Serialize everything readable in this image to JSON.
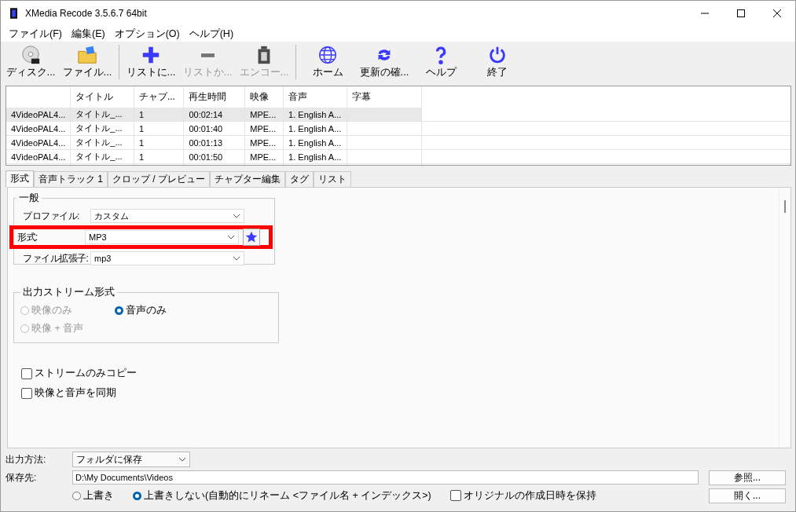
{
  "window": {
    "title": "XMedia Recode 3.5.6.7 64bit"
  },
  "menu": [
    "ファイル(F)",
    "編集(E)",
    "オプション(O)",
    "ヘルプ(H)"
  ],
  "toolbar": [
    {
      "kind": "disc",
      "label": "ディスク...",
      "disabled": false
    },
    {
      "kind": "folder",
      "label": "ファイル...",
      "disabled": false
    },
    {
      "kind": "sep"
    },
    {
      "kind": "plus",
      "label": "リストに...",
      "disabled": false
    },
    {
      "kind": "minus",
      "label": "リストか...",
      "disabled": true
    },
    {
      "kind": "encode",
      "label": "エンコー...",
      "disabled": true
    },
    {
      "kind": "sep"
    },
    {
      "kind": "globe",
      "label": "ホーム",
      "disabled": false
    },
    {
      "kind": "refresh",
      "label": "更新の確...",
      "disabled": false
    },
    {
      "kind": "help",
      "label": "ヘルプ",
      "disabled": false
    },
    {
      "kind": "power",
      "label": "終了",
      "disabled": false
    }
  ],
  "table": {
    "columns": [
      "",
      "タイトル",
      "チャプ...",
      "再生時間",
      "映像",
      "音声",
      "字幕"
    ],
    "rows": [
      {
        "selected": true,
        "cells": [
          "4VideoPAL4...",
          "タイトル_...",
          "1",
          "00:02:14",
          "MPE...",
          "1. English A...",
          ""
        ]
      },
      {
        "selected": false,
        "cells": [
          "4VideoPAL4...",
          "タイトル_...",
          "1",
          "00:01:40",
          "MPE...",
          "1. English A...",
          ""
        ]
      },
      {
        "selected": false,
        "cells": [
          "4VideoPAL4...",
          "タイトル_...",
          "1",
          "00:01:13",
          "MPE...",
          "1. English A...",
          ""
        ]
      },
      {
        "selected": false,
        "cells": [
          "4VideoPAL4...",
          "タイトル_...",
          "1",
          "00:01:50",
          "MPE...",
          "1. English A...",
          ""
        ]
      }
    ]
  },
  "tabs": [
    {
      "label": "形式",
      "selected": true
    },
    {
      "label": "音声トラック 1",
      "selected": false
    },
    {
      "label": "クロップ / プレビュー",
      "selected": false
    },
    {
      "label": "チャプター編集",
      "selected": false
    },
    {
      "label": "タグ",
      "selected": false
    },
    {
      "label": "リスト",
      "selected": false
    }
  ],
  "general": {
    "title": "一般",
    "fields": [
      {
        "label": "プロファイル:",
        "value": "カスタム",
        "highlighted": false,
        "favorite": false
      },
      {
        "label": "形式:",
        "value": "MP3",
        "highlighted": true,
        "favorite": true
      },
      {
        "label": "ファイル拡張子:",
        "value": "mp3",
        "highlighted": false,
        "favorite": false
      }
    ]
  },
  "output_stream": {
    "title": "出力ストリーム形式",
    "options": [
      {
        "label": "映像のみ",
        "selected": false,
        "disabled": true
      },
      {
        "label": "音声のみ",
        "selected": true,
        "disabled": false
      },
      {
        "label": "映像 + 音声",
        "selected": false,
        "disabled": true
      }
    ]
  },
  "checkboxes": [
    {
      "label": "ストリームのみコピー",
      "checked": false
    },
    {
      "label": "映像と音声を同期",
      "checked": false
    }
  ],
  "bottom": {
    "output_method_label": "出力方法:",
    "output_method": "フォルダに保存",
    "destination_label": "保存先:",
    "destination": "D:\\My Documents\\Videos",
    "browse": "参照...",
    "open": "開く...",
    "overwrite_options": [
      {
        "label": "上書き",
        "selected": false
      },
      {
        "label": "上書きしない(自動的にリネーム <ファイル名 + インデックス>)",
        "selected": true
      }
    ],
    "keep_date": {
      "label": "オリジナルの作成日時を保持",
      "checked": false
    }
  }
}
